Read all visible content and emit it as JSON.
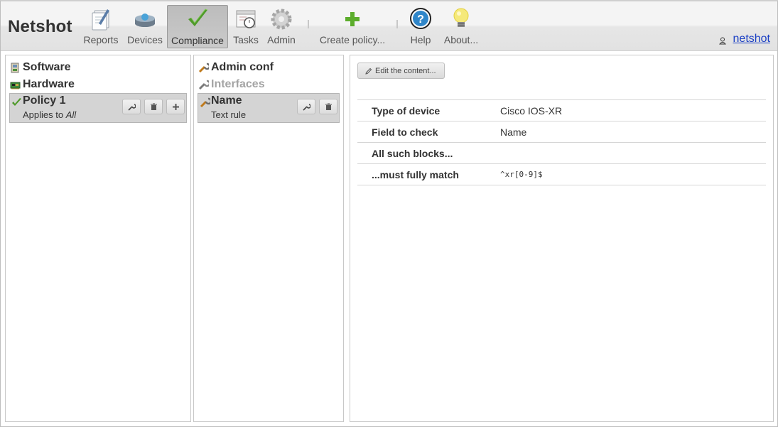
{
  "app": {
    "title": "Netshot"
  },
  "nav": {
    "items": [
      {
        "label": "Reports",
        "icon": "reports-icon"
      },
      {
        "label": "Devices",
        "icon": "devices-icon"
      },
      {
        "label": "Compliance",
        "icon": "compliance-icon",
        "active": true
      },
      {
        "label": "Tasks",
        "icon": "tasks-icon"
      },
      {
        "label": "Admin",
        "icon": "admin-icon"
      },
      {
        "label": "Create policy...",
        "icon": "plus-icon"
      },
      {
        "label": "Help",
        "icon": "help-icon"
      },
      {
        "label": "About...",
        "icon": "lightbulb-icon"
      }
    ]
  },
  "user": {
    "name": "netshot",
    "icon": "user-icon"
  },
  "policies": {
    "items": [
      {
        "label": "Software",
        "icon": "software-icon"
      },
      {
        "label": "Hardware",
        "icon": "hardware-icon"
      },
      {
        "label": "Policy 1",
        "icon": "check-icon",
        "applies_prefix": "Applies to ",
        "applies_target": "All",
        "selected": true
      }
    ]
  },
  "rules": {
    "items": [
      {
        "label": "Admin conf",
        "icon": "wrench-icon",
        "enabled": true
      },
      {
        "label": "Interfaces",
        "icon": "wrench-icon",
        "enabled": false
      },
      {
        "label": "Name",
        "icon": "wrench-icon",
        "subtitle": "Text rule",
        "selected": true
      }
    ]
  },
  "detail": {
    "edit_label": "Edit the content...",
    "rows": [
      {
        "key": "Type of device",
        "value": "Cisco IOS-XR"
      },
      {
        "key": "Field to check",
        "value": "Name"
      },
      {
        "key": "All such blocks...",
        "value": ""
      },
      {
        "key": "...must fully match",
        "value": "^xr[0-9]$"
      }
    ]
  },
  "colors": {
    "link": "#1a3fc4",
    "active_nav": "#c2c2c2",
    "selected_row": "#d4d4d4",
    "accent_green": "#5aa02c"
  }
}
